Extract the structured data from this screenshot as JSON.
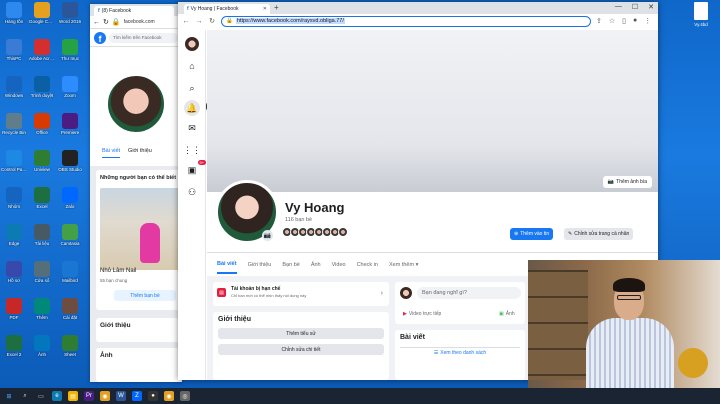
{
  "desktop": {
    "icons": [
      {
        "label": "Hàng tồn",
        "color": "#2d89ef"
      },
      {
        "label": "Google Chrome",
        "color": "#e6a01f"
      },
      {
        "label": "Word 2016",
        "color": "#2b579a"
      },
      {
        "label": "ThisPC",
        "color": "#3a7bd5"
      },
      {
        "label": "Adobe Acrobat",
        "color": "#d32f2f"
      },
      {
        "label": "Thư mục",
        "color": "#25a244"
      },
      {
        "label": "Windows",
        "color": "#1565c0"
      },
      {
        "label": "Trình duyệt",
        "color": "#0b5fa5"
      },
      {
        "label": "Zoom",
        "color": "#2d8cff"
      },
      {
        "label": "Recycle Bin",
        "color": "#607d8b"
      },
      {
        "label": "Office",
        "color": "#d83b01"
      },
      {
        "label": "Premiere",
        "color": "#4b1c82"
      },
      {
        "label": "Control Panel",
        "color": "#1e88e5"
      },
      {
        "label": "Uniview",
        "color": "#2e7d32"
      },
      {
        "label": "OBS Studio",
        "color": "#222222"
      },
      {
        "label": "Nhóm",
        "color": "#1565c0"
      },
      {
        "label": "Excel",
        "color": "#1d6f42"
      },
      {
        "label": "Zalo",
        "color": "#0068ff"
      },
      {
        "label": "Edge",
        "color": "#0c7bb3"
      },
      {
        "label": "Tài liệu",
        "color": "#455a64"
      },
      {
        "label": "Camtasia",
        "color": "#43a047"
      },
      {
        "label": "Hồ sơ",
        "color": "#3949ab"
      },
      {
        "label": "Cửa sổ",
        "color": "#546e7a"
      },
      {
        "label": "Mailbird",
        "color": "#1976d2"
      },
      {
        "label": "PDF",
        "color": "#c62828"
      },
      {
        "label": "Thêm",
        "color": "#00897b"
      },
      {
        "label": "Cài đặt",
        "color": "#6d4c41"
      },
      {
        "label": "Excel 2",
        "color": "#1d6f42"
      },
      {
        "label": "Ảnh",
        "color": "#0277bd"
      },
      {
        "label": "Sheet",
        "color": "#2e7d32"
      }
    ],
    "right_file_label": "Vy.4bd"
  },
  "back_window": {
    "tab_title": "(8) Facebook",
    "url": "facebook.com",
    "search_placeholder": "Tìm kiếm trên Facebook",
    "tabs": [
      "Bài viết",
      "Giới thiệu"
    ],
    "suggest_title": "Những người bạn có thể biết",
    "friend_name": "Nhỏ Lâm Nail",
    "mutual": "55 bạn chung",
    "add_friend": "Thêm bạn bè",
    "intro_label": "Giới thiệu",
    "photos_label": "Ảnh"
  },
  "main_window": {
    "tab_title": "Vy Hoang | Facebook",
    "url": "https://www.facebook.com/raysvd.obliga.77/",
    "controls": {
      "minimize": "—",
      "maximize": "☐",
      "close": "✕"
    },
    "tooltip": "Thông báo",
    "notif_count": "9+"
  },
  "profile": {
    "name": "Vy Hoang",
    "friend_count": "116 bạn bè",
    "cover_button": "Thêm ảnh bìa",
    "add_story": "Thêm vào tin",
    "edit_profile": "Chỉnh sửa trang cá nhân",
    "tabs": [
      "Bài viết",
      "Giới thiệu",
      "Bạn bè",
      "Ảnh",
      "Video",
      "Check in",
      "Xem thêm ▾"
    ],
    "restricted_title": "Tài khoản bị hạn chế",
    "restricted_sub": "Chỉ bạn mới có thể nhìn thấy nội dung này",
    "intro_title": "Giới thiệu",
    "add_bio": "Thêm tiểu sử",
    "edit_details": "Chỉnh sửa chi tiết",
    "composer_placeholder": "Bạn đang nghĩ gì?",
    "live_video": "Video trực tiếp",
    "photo_option": "Ảnh",
    "posts_title": "Bài viết",
    "list_view": "Xem theo danh sách"
  },
  "taskbar": {
    "icons": [
      "start-icon",
      "search-icon",
      "task-view-icon",
      "edge-icon",
      "explorer-icon",
      "premiere-icon",
      "chrome-icon",
      "word-icon",
      "zalo-icon",
      "obs-icon",
      "chrome-icon-2",
      "camera-icon"
    ]
  }
}
